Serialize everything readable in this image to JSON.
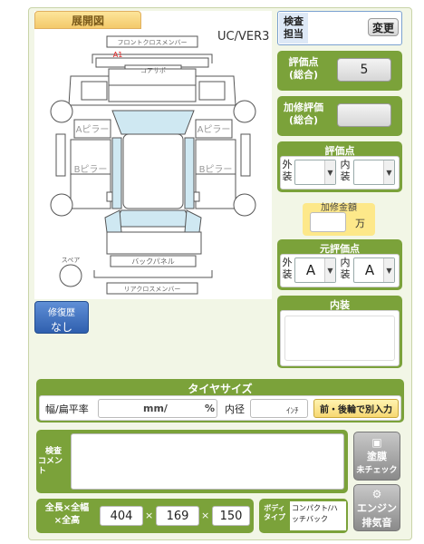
{
  "diagram": {
    "tab_label": "展開図",
    "version": "UC/VER3",
    "labels": {
      "front_cross_member": "フロントクロスメンバー",
      "a1": "A1",
      "core_support": "コアサポ",
      "a_pillar_left": "Aピラー",
      "a_pillar_right": "Aピラー",
      "b_pillar_left": "Bピラー",
      "b_pillar_right": "Bピラー",
      "back_panel": "バックパネル",
      "rear_cross_member": "リアクロスメンバー",
      "spare": "スペア"
    }
  },
  "repair_history": {
    "label": "修復歴",
    "value": "なし"
  },
  "inspection": {
    "label": "検査担当",
    "change_button": "変更"
  },
  "score_total": {
    "label": "評価点(総合)",
    "value": "5"
  },
  "repair_eval": {
    "label": "加修評価(総合)",
    "value": ""
  },
  "score": {
    "title": "評価点",
    "exterior": "外装",
    "interior": "内装"
  },
  "repair_amount": {
    "label": "加修金額",
    "unit": "万"
  },
  "original_score": {
    "title": "元評価点",
    "exterior": "外装",
    "exterior_value": "A",
    "interior": "内装",
    "interior_value": "A"
  },
  "interior_panel": {
    "title": "内装"
  },
  "tire": {
    "title": "タイヤサイズ",
    "width_label": "幅/扁平率",
    "mm_unit": "mm/",
    "pct_unit": "%",
    "inner_label": "内径",
    "inch_unit": "ｲﾝﾁ",
    "front_rear_button": "前・後輪で別入力"
  },
  "comment": {
    "label": "コメント",
    "label_prefix": "検査"
  },
  "paint_button": {
    "line1": "塗膜",
    "line2": "未チェック"
  },
  "engine_button": {
    "line1": "エンジン",
    "line2": "排気音"
  },
  "dimensions": {
    "label": "全長×全幅×全高",
    "length": "404",
    "width": "169",
    "height": "150",
    "sep": "×"
  },
  "body_type": {
    "label": "ボディタイプ",
    "value": "コンパクト/ハッチバック"
  }
}
